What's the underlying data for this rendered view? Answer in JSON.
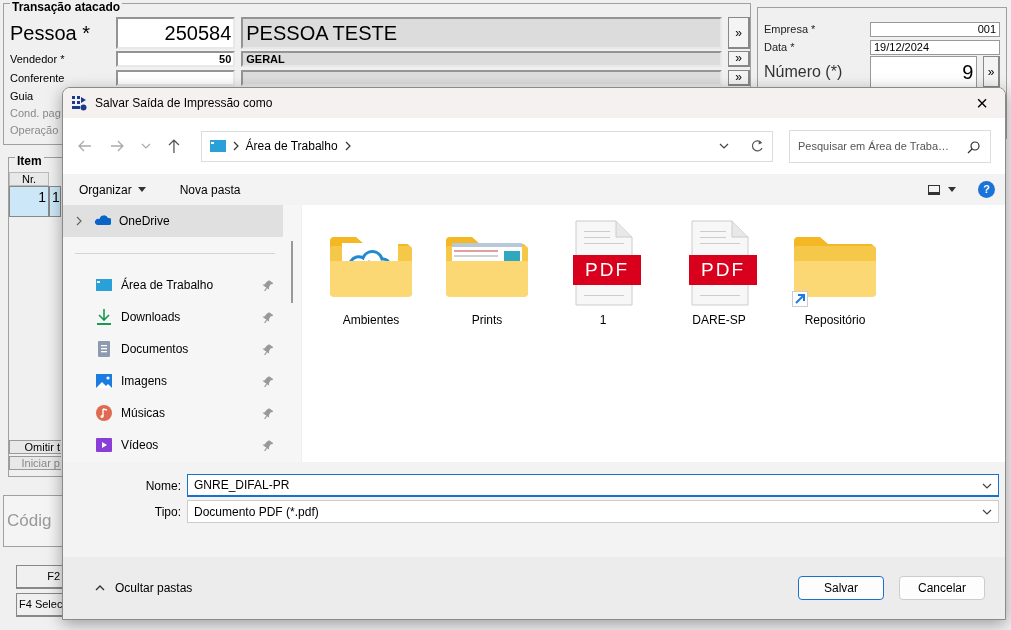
{
  "app": {
    "header": {
      "title": "Transação atacado",
      "rows": [
        {
          "label": "Pessoa *",
          "code": "250584",
          "name": "PESSOA TESTE",
          "button": "»",
          "disabled": false
        },
        {
          "label": "Vendedor *",
          "code": "50",
          "name": "GERAL",
          "button": "»",
          "disabled": false
        },
        {
          "label": "Conferente",
          "button": "»",
          "disabled": false
        },
        {
          "label": "Guia",
          "disabled": false
        },
        {
          "label": "Cond. pag",
          "disabled": true
        },
        {
          "label": "Operação",
          "disabled": true
        }
      ]
    },
    "company": {
      "fields": [
        {
          "label": "Empresa *",
          "value": "001"
        },
        {
          "label": "Data *",
          "value": "19/12/2024"
        },
        {
          "label": "Número (*)",
          "value": "9",
          "button": "»"
        }
      ]
    },
    "items": {
      "title": "Item",
      "columns": [
        "Nr."
      ],
      "rows": [
        {
          "cells": [
            "1",
            "1"
          ],
          "selected": true
        }
      ],
      "buttons": [
        {
          "label": "Omitir t",
          "disabled": false
        },
        {
          "label": "Iniciar p",
          "disabled": true
        }
      ]
    },
    "code_box": {
      "label": "Códig"
    },
    "function_keys": [
      "F2",
      "F4 Selec"
    ]
  },
  "dialog": {
    "title": "Salvar Saída de Impressão como",
    "close": "×",
    "address": {
      "path": "Área de Trabalho"
    },
    "search": {
      "placeholder": "Pesquisar em Área de Traba…"
    },
    "toolbar": {
      "organize": "Organizar",
      "new_folder": "Nova pasta",
      "help": "?"
    },
    "sidebar": [
      {
        "label": "OneDrive",
        "kind": "cloud",
        "expandable": true,
        "pinned": false,
        "selected": true
      },
      {
        "label": "Área de Trabalho",
        "kind": "desktop",
        "expandable": false,
        "pinned": true,
        "selected": false
      },
      {
        "label": "Downloads",
        "kind": "download",
        "expandable": false,
        "pinned": true,
        "selected": false
      },
      {
        "label": "Documentos",
        "kind": "document",
        "expandable": false,
        "pinned": true,
        "selected": false
      },
      {
        "label": "Imagens",
        "kind": "image",
        "expandable": false,
        "pinned": true,
        "selected": false
      },
      {
        "label": "Músicas",
        "kind": "music",
        "expandable": false,
        "pinned": true,
        "selected": false
      },
      {
        "label": "Vídeos",
        "kind": "video",
        "expandable": false,
        "pinned": true,
        "selected": false
      }
    ],
    "files": [
      {
        "name": "Ambientes",
        "kind": "folder",
        "shortcut": false
      },
      {
        "name": "Prints",
        "kind": "folder",
        "shortcut": false
      },
      {
        "name": "1",
        "kind": "pdf",
        "badge": "PDF",
        "shortcut": false
      },
      {
        "name": "DARE-SP",
        "kind": "pdf",
        "badge": "PDF",
        "shortcut": false
      },
      {
        "name": "Repositório",
        "kind": "folder",
        "shortcut": true
      }
    ],
    "filename": {
      "label": "Nome:",
      "value": "GNRE_DIFAL-PR"
    },
    "filetype": {
      "label": "Tipo:",
      "value": "Documento PDF (*.pdf)"
    },
    "toggle_folders": "Ocultar pastas",
    "buttons": [
      {
        "label": "Salvar",
        "primary": true
      },
      {
        "label": "Cancelar",
        "primary": false
      }
    ]
  }
}
